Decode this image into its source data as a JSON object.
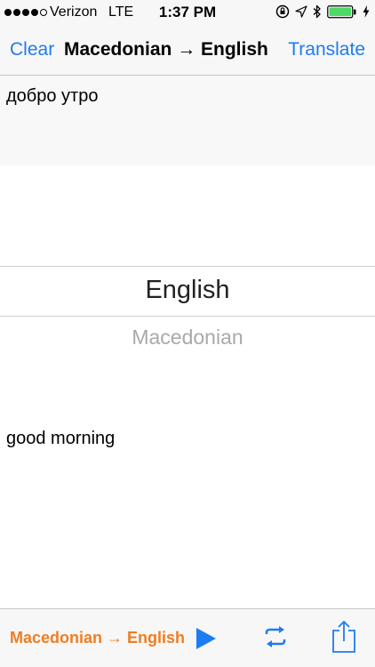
{
  "status_bar": {
    "carrier": "Verizon",
    "network": "LTE",
    "time": "1:37 PM",
    "signal_bars_filled": 4,
    "signal_bars_total": 5,
    "battery_color": "#4cd964"
  },
  "nav": {
    "clear_label": "Clear",
    "title": "Macedonian → English",
    "translate_label": "Translate",
    "accent_color": "#1d7cf2"
  },
  "source": {
    "text": "добро утро"
  },
  "picker": {
    "selected": "English",
    "next": "Macedonian"
  },
  "result": {
    "text": "good morning"
  },
  "toolbar": {
    "direction_label": "Macedonian → English",
    "direction_color": "#ef7d22",
    "play_icon": "play-icon",
    "swap_icon": "swap-icon",
    "share_icon": "share-icon"
  }
}
